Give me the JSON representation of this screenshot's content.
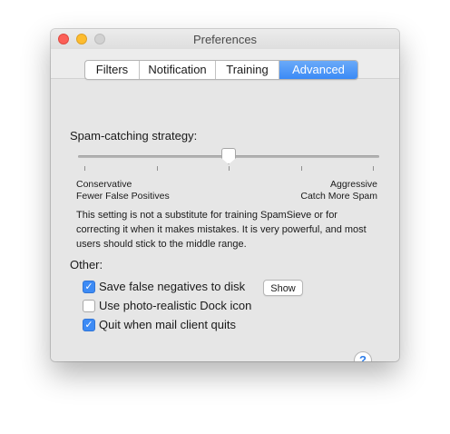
{
  "window": {
    "title": "Preferences"
  },
  "tabs": [
    {
      "label": "Filters",
      "active": false
    },
    {
      "label": "Notification",
      "active": false
    },
    {
      "label": "Training",
      "active": false
    },
    {
      "label": "Advanced",
      "active": true
    }
  ],
  "strategy": {
    "heading": "Spam-catching strategy:",
    "slider_value_fraction": 0.5,
    "tick_count": 5,
    "left_label_1": "Conservative",
    "left_label_2": "Fewer False Positives",
    "right_label_1": "Aggressive",
    "right_label_2": "Catch More Spam",
    "description": "This setting is not a substitute for training SpamSieve or for correcting it when it makes mistakes. It is very powerful, and most users should stick to the middle range."
  },
  "other": {
    "heading": "Other:",
    "options": [
      {
        "label": "Save false negatives to disk",
        "checked": true
      },
      {
        "label": "Use photo-realistic Dock icon",
        "checked": false
      },
      {
        "label": "Quit when mail client quits",
        "checked": true
      }
    ],
    "show_button_label": "Show"
  },
  "help": {
    "glyph": "?"
  },
  "colors": {
    "accent": "#3d8bf5",
    "close": "#fc5f57",
    "minimize": "#fdbc2e",
    "zoom": "#d1d1d1"
  },
  "icons": {
    "checkmark": "checkmark-icon",
    "help": "question-mark-icon"
  }
}
